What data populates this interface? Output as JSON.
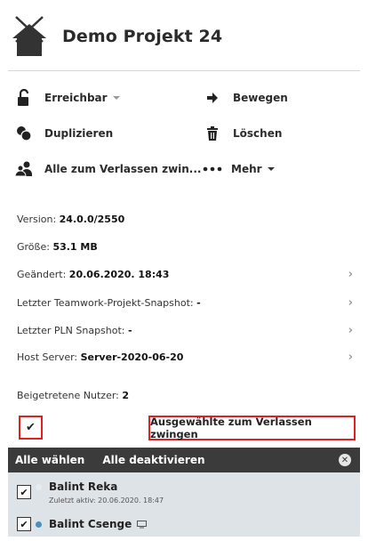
{
  "header": {
    "title": "Demo Projekt 24",
    "icon": "house-icon"
  },
  "actions": {
    "reachable": "Erreichbar",
    "move": "Bewegen",
    "duplicate": "Duplizieren",
    "delete": "Löschen",
    "force_leave_all": "Alle zum Verlassen zwin...",
    "more": "Mehr"
  },
  "info": {
    "version_label": "Version: ",
    "version_value": "24.0.0/2550",
    "size_label": "Größe: ",
    "size_value": "53.1 MB",
    "changed_label": "Geändert: ",
    "changed_value": "20.06.2020. 18:43",
    "teamwork_label": "Letzter Teamwork-Projekt-Snapshot: ",
    "teamwork_value": "-",
    "pln_label": "Letzter PLN Snapshot: ",
    "pln_value": "-",
    "host_label": "Host Server: ",
    "host_value": "Server-2020-06-20",
    "joined_label": "Beigetretene Nutzer: ",
    "joined_value": "2"
  },
  "selection": {
    "select_all_checked": "✔",
    "force_selected": "Ausgewählte zum Verlassen zwingen",
    "select_all": "Alle wählen",
    "deselect_all": "Alle deaktivieren"
  },
  "users": [
    {
      "name": "Balint Reka",
      "status": "Zuletzt aktiv: 20.06.2020. 18:47",
      "online": false,
      "check": "✔"
    },
    {
      "name": "Balint Csenge",
      "status": "",
      "online": true,
      "check": "✔"
    }
  ],
  "colors": {
    "accent_red": "#e02020",
    "online_dot": "#4a90b8",
    "bar": "#3b3b3b"
  }
}
